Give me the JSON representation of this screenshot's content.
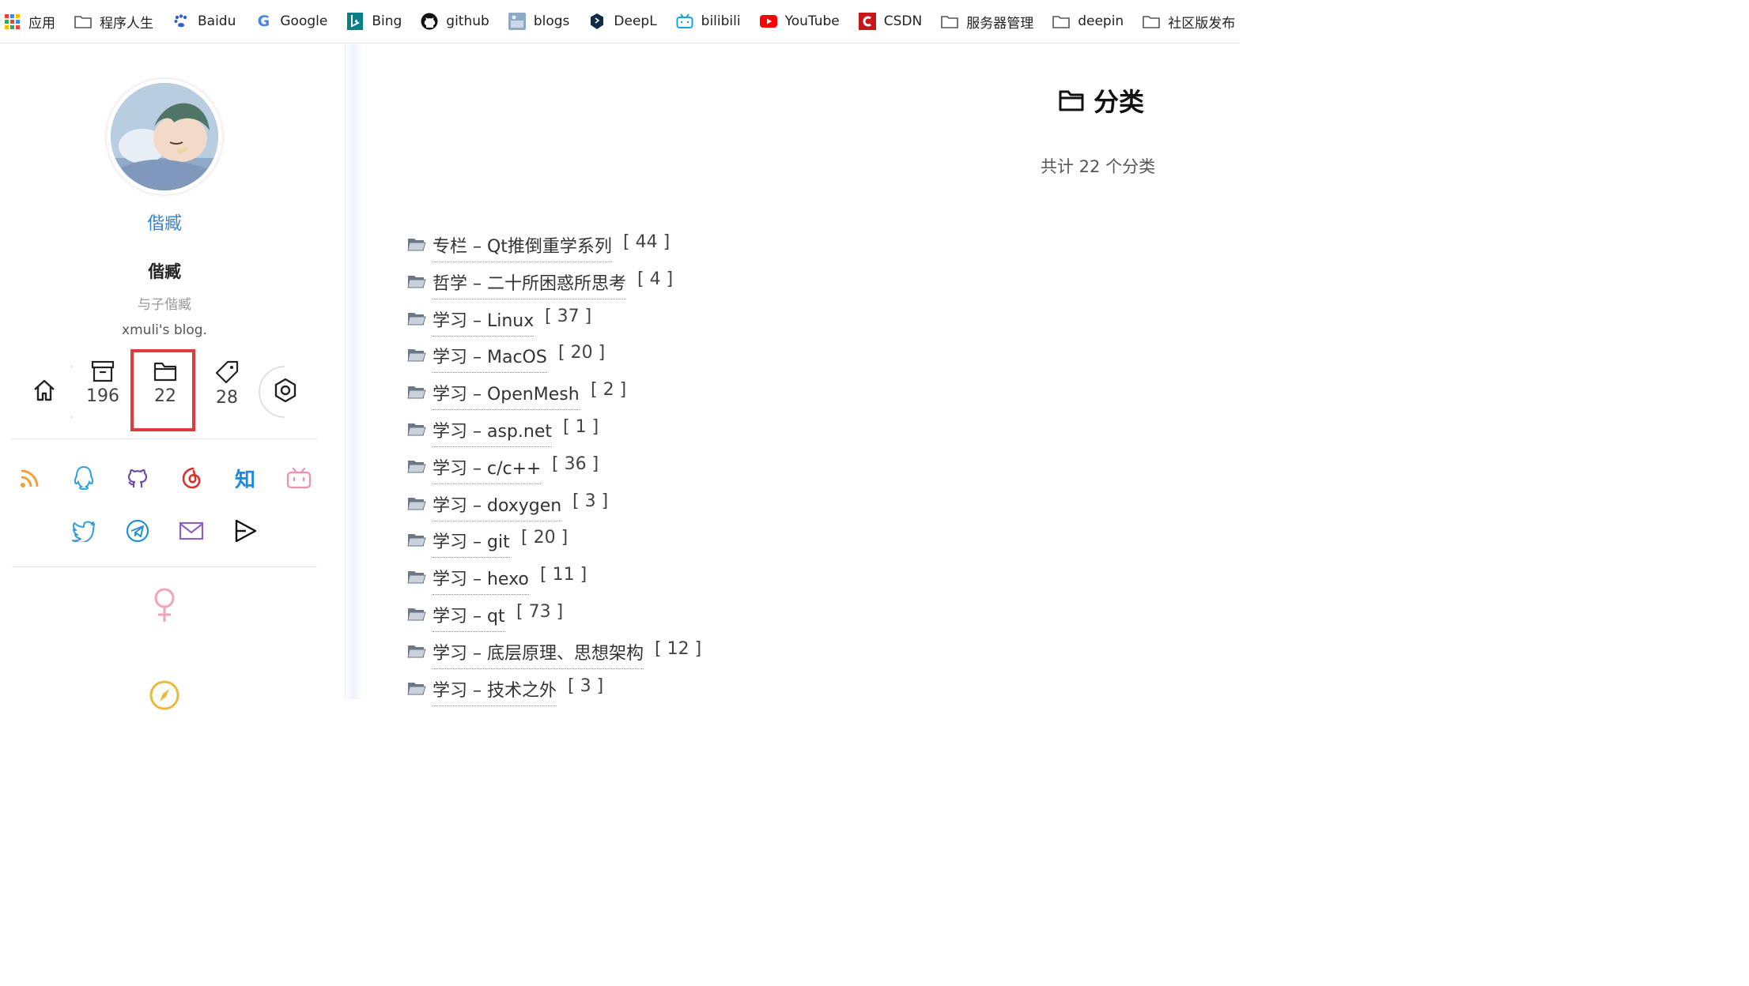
{
  "bookmarks": [
    {
      "label": "应用",
      "icon": "apps-grid-icon"
    },
    {
      "label": "程序人生",
      "icon": "folder-icon"
    },
    {
      "label": "Baidu",
      "icon": "baidu-paw-icon"
    },
    {
      "label": "Google",
      "icon": "google-g-icon"
    },
    {
      "label": "Bing",
      "icon": "bing-icon"
    },
    {
      "label": "github",
      "icon": "github-icon"
    },
    {
      "label": "blogs",
      "icon": "blogs-thumbnail-icon"
    },
    {
      "label": "DeepL",
      "icon": "deepl-icon"
    },
    {
      "label": "bilibili",
      "icon": "bilibili-icon"
    },
    {
      "label": "YouTube",
      "icon": "youtube-icon"
    },
    {
      "label": "CSDN",
      "icon": "csdn-icon"
    },
    {
      "label": "服务器管理",
      "icon": "folder-icon"
    },
    {
      "label": "deepin",
      "icon": "folder-icon"
    },
    {
      "label": "社区版发布",
      "icon": "folder-icon"
    }
  ],
  "sidebar": {
    "author_link": "偕臧",
    "author_name": "偕臧",
    "motto": "与子偕臧",
    "description": "xmuli's blog.",
    "stats": {
      "archives": "196",
      "categories": "22",
      "tags": "28"
    },
    "social": [
      "rss-icon",
      "qq-icon",
      "github-icon",
      "netease-music-icon",
      "zhihu-icon",
      "bilibili-icon",
      "twitter-icon",
      "telegram-icon",
      "mail-icon",
      "send-icon"
    ],
    "zhihu_text": "知",
    "colors": {
      "link": "#3b82c4",
      "highlight": "#e0393e"
    }
  },
  "main": {
    "title": "分类",
    "total_text": "共计 22 个分类",
    "categories": [
      {
        "name": "专栏 – Qt推倒重学系列",
        "count": "[ 44 ]"
      },
      {
        "name": "哲学 – 二十所困惑所思考",
        "count": "[ 4 ]"
      },
      {
        "name": "学习 – Linux",
        "count": "[ 37 ]"
      },
      {
        "name": "学习 – MacOS",
        "count": "[ 20 ]"
      },
      {
        "name": "学习 – OpenMesh",
        "count": "[ 2 ]"
      },
      {
        "name": "学习 – asp.net",
        "count": "[ 1 ]"
      },
      {
        "name": "学习 – c/c++",
        "count": "[ 36 ]"
      },
      {
        "name": "学习 – doxygen",
        "count": "[ 3 ]"
      },
      {
        "name": "学习 – git",
        "count": "[ 20 ]"
      },
      {
        "name": "学习 – hexo",
        "count": "[ 11 ]"
      },
      {
        "name": "学习 – qt",
        "count": "[ 73 ]"
      },
      {
        "name": "学习 – 底层原理、思想架构",
        "count": "[ 12 ]"
      },
      {
        "name": "学习 – 技术之外",
        "count": "[ 3 ]"
      }
    ]
  }
}
